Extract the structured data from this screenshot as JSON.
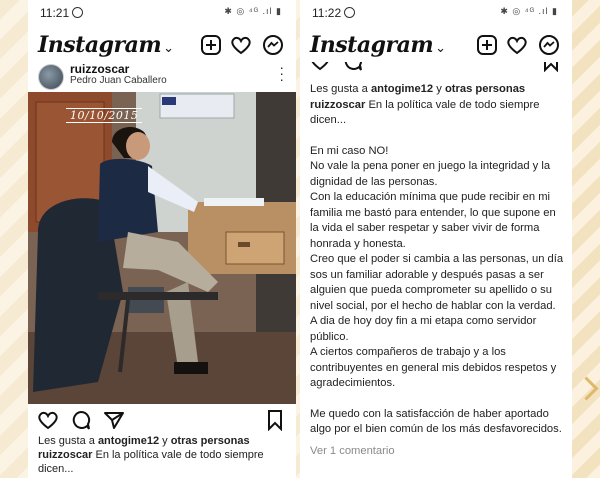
{
  "left": {
    "status": {
      "time": "11:21",
      "indicators": "✱ ◎ ⁴ᴳ .ıl ▮"
    },
    "app_title": "Instagram",
    "post": {
      "username": "ruizzoscar",
      "location": "Pedro Juan Caballero",
      "photo_stamp": "10/10/2015",
      "likes_prefix": "Les gusta a ",
      "likes_user": "antogime12",
      "likes_mid": " y ",
      "likes_others": "otras personas",
      "caption_user": "ruizzoscar",
      "caption_text": " En la política vale de todo siempre dicen..."
    }
  },
  "right": {
    "status": {
      "time": "11:22",
      "indicators": "✱ ◎ ⁴ᴳ .ıl ▮"
    },
    "app_title": "Instagram",
    "likes_prefix": "Les gusta a ",
    "likes_user": "antogime12",
    "likes_mid": " y ",
    "likes_others": "otras personas",
    "caption_user": "ruizzoscar",
    "caption_intro": " En la política vale de todo siempre dicen...",
    "paragraphs": [
      "En mi caso NO!",
      "No vale la pena poner en juego la integridad y la dignidad de las personas.",
      "Con la educación mínima que pude recibir en mi familia me bastó para entender, lo que supone en la vida el saber respetar y saber vivir de forma honrada y honesta.",
      "Creo que el poder si cambia a las personas, un día sos un familiar adorable y después pasas a ser alguien que pueda comprometer su apellido o su nivel social, por el hecho de hablar con la verdad.",
      "A dia de hoy doy fin a mi etapa como servidor público.",
      "A ciertos compañeros de trabajo y a los contribuyentes en general mis debidos respetos y agradecimientos.",
      "Me quedo con la satisfacción de haber aportado algo por el bien común de los más desfavorecidos."
    ],
    "comments": "Ver 1 comentario"
  },
  "icons": [
    "new-post-icon",
    "heart-icon",
    "messenger-icon",
    "comment-icon",
    "share-icon",
    "bookmark-icon"
  ]
}
